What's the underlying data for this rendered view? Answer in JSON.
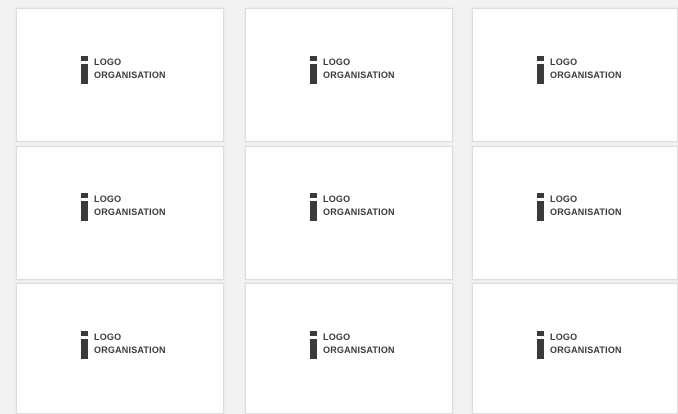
{
  "cards": [
    {
      "line1": "LOGO",
      "line2": "ORGANISATION"
    },
    {
      "line1": "LOGO",
      "line2": "ORGANISATION"
    },
    {
      "line1": "LOGO",
      "line2": "ORGANISATION"
    },
    {
      "line1": "LOGO",
      "line2": "ORGANISATION"
    },
    {
      "line1": "LOGO",
      "line2": "ORGANISATION"
    },
    {
      "line1": "LOGO",
      "line2": "ORGANISATION"
    },
    {
      "line1": "LOGO",
      "line2": "ORGANISATION"
    },
    {
      "line1": "LOGO",
      "line2": "ORGANISATION"
    },
    {
      "line1": "LOGO",
      "line2": "ORGANISATION"
    }
  ],
  "colors": {
    "background": "#f2f2f2",
    "card": "#ffffff",
    "logo": "#3a3a3a"
  },
  "icons": {
    "logo_mark": "letter-i-logo-icon"
  }
}
